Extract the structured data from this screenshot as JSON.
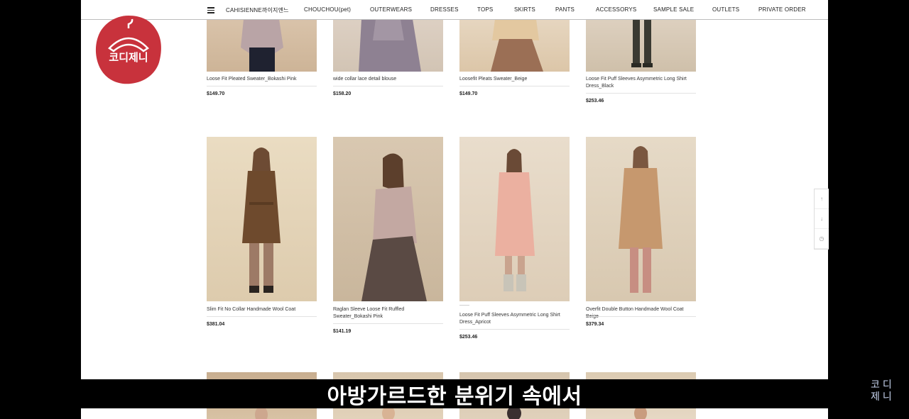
{
  "nav": {
    "items": [
      "CAHISIENNE까이지엔느",
      "CHOUCHOU(pet)",
      "OUTERWEARS",
      "DRESSES",
      "TOPS",
      "SKIRTS",
      "PANTS",
      "ACCESSORYS",
      "SAMPLE SALE",
      "OUTLETS",
      "PRIVATE ORDER"
    ]
  },
  "products_top": [
    {
      "title": "Loose Fit Pleated Sweater_Bokashi Pink",
      "price": "$149.70"
    },
    {
      "title": "wide collar lace detail blouse",
      "price": "$158.20"
    },
    {
      "title": "Loosefit Pleats Sweater_Beige",
      "price": "$149.70"
    },
    {
      "title": "Loose Fit Puff Sleeves Asymmetric Long Shirt Dress_Black",
      "price": "$253.46"
    }
  ],
  "products_mid": [
    {
      "title": "Slim Fit No Collar Handmade Wool Coat",
      "price": "$381.04"
    },
    {
      "title": "Raglan Sleeve Loose Fit Ruffled Sweater_Bokashi Pink",
      "price": "$141.19"
    },
    {
      "title": "Loose Fit Puff Sleeves Asymmetric Long Shirt Dress_Apricot",
      "price": "$253.46"
    },
    {
      "title": "Overfit Double Button Handmade Wool Coat Beige",
      "price": "$379.34"
    }
  ],
  "logo": {
    "text": "코디제니"
  },
  "subtitle": {
    "text": "아방가르드한 분위기 속에서"
  },
  "watermark": {
    "line1": "코디",
    "line2": "제니"
  },
  "quick_menu": {
    "up": "↑",
    "down": "↓",
    "recent": "◷"
  },
  "colors": {
    "logo_red": "#c8323c",
    "background": "#000000",
    "nav_border": "#bdbdbd",
    "watermark": "#c7d4ef"
  }
}
